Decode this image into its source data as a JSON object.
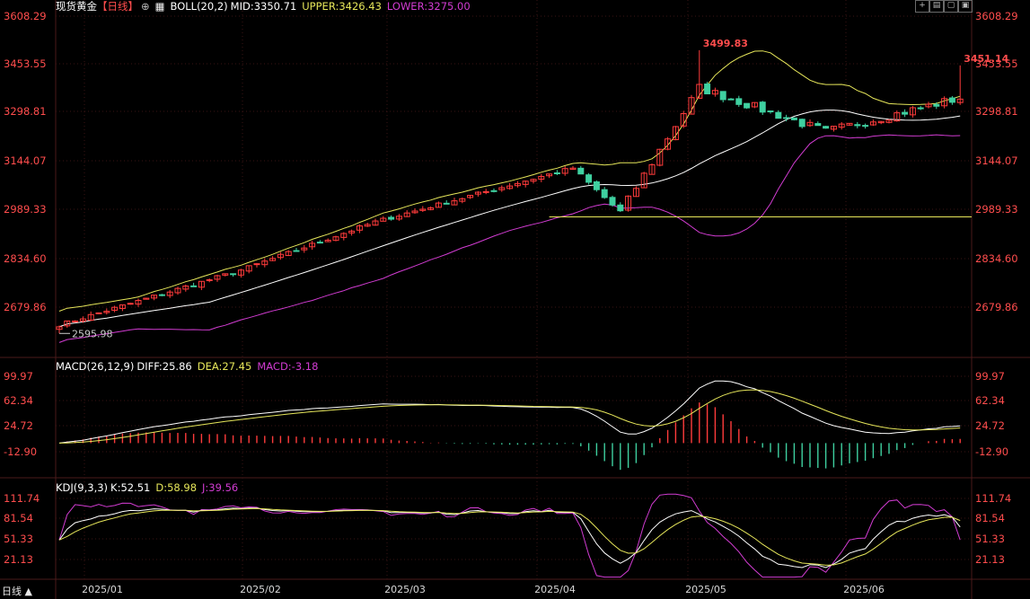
{
  "header": {
    "symbol": "现货黄金",
    "period": "【日线】",
    "boll_label": "BOLL(20,2)",
    "mid": "MID:3350.71",
    "upper": "UPPER:3426.43",
    "lower": "LOWER:3275.00"
  },
  "macd_legend": {
    "name": "MACD(26,12,9)",
    "diff": "DIFF:25.86",
    "dea": "DEA:27.45",
    "macd": "MACD:-3.18"
  },
  "kdj_legend": {
    "name": "KDJ(9,3,3)",
    "k": "K:52.51",
    "d": "D:58.98",
    "j": "J:39.56"
  },
  "footer": {
    "period_button": "日线 ▲"
  },
  "toolbar": {
    "icons": [
      "add-window-icon",
      "window-split-icon",
      "window-restore-icon",
      "window-toggle-icon"
    ]
  },
  "colors": {
    "up": "#ff3b3b",
    "down": "#3fd0a0",
    "mid": "#ffffff",
    "upper": "#e6e65a",
    "lower": "#d23cd2",
    "axis_label": "#ff4d4d",
    "grid": "#3a1414",
    "support": "#e6e65a"
  },
  "chart_data": [
    {
      "type": "candlestick",
      "title": "现货黄金【日线】",
      "x_labels": [
        "2025/01",
        "2025/02",
        "2025/03",
        "2025/04",
        "2025/05",
        "2025/06"
      ],
      "y_ticks": [
        "3608.29",
        "3453.55",
        "3298.81",
        "3144.07",
        "2989.33",
        "2834.60",
        "2679.86"
      ],
      "ylim": [
        2595.98,
        3608.29
      ],
      "annotations": [
        {
          "label": "3499.83",
          "value": 3499.83,
          "date": "2025-04-22"
        },
        {
          "label": "3451.14",
          "value": 3451.14,
          "date": "2025-06-16"
        },
        {
          "label": "2595.98",
          "value": 2595.98,
          "date": "2024-12-30"
        }
      ],
      "support_level": 2968,
      "key_closes": [
        {
          "date": "2024-12-30",
          "close": 2623
        },
        {
          "date": "2025-01-31",
          "close": 2798
        },
        {
          "date": "2025-02-24",
          "close": 2952
        },
        {
          "date": "2025-03-31",
          "close": 3124
        },
        {
          "date": "2025-04-08",
          "close": 2982
        },
        {
          "date": "2025-04-22",
          "close": 3380
        },
        {
          "date": "2025-05-15",
          "close": 3240
        },
        {
          "date": "2025-06-16",
          "close": 3385
        },
        {
          "date": "2025-06-20",
          "close": 3370
        }
      ],
      "series": [
        {
          "name": "MID",
          "last": 3350.71
        },
        {
          "name": "UPPER",
          "last": 3426.43
        },
        {
          "name": "LOWER",
          "last": 3275.0
        }
      ]
    },
    {
      "type": "bar+line",
      "title": "MACD(26,12,9)",
      "y_ticks": [
        "99.97",
        "62.34",
        "24.72",
        "-12.90"
      ],
      "ylim": [
        -12.9,
        99.97
      ],
      "series": [
        {
          "name": "DIFF",
          "last": 25.86
        },
        {
          "name": "DEA",
          "last": 27.45
        },
        {
          "name": "MACD",
          "last": -3.18
        }
      ]
    },
    {
      "type": "line",
      "title": "KDJ(9,3,3)",
      "y_ticks": [
        "111.74",
        "81.54",
        "51.33",
        "21.13"
      ],
      "ylim": [
        21.13,
        111.74
      ],
      "series": [
        {
          "name": "K",
          "last": 52.51
        },
        {
          "name": "D",
          "last": 58.98
        },
        {
          "name": "J",
          "last": 39.56
        }
      ]
    }
  ]
}
